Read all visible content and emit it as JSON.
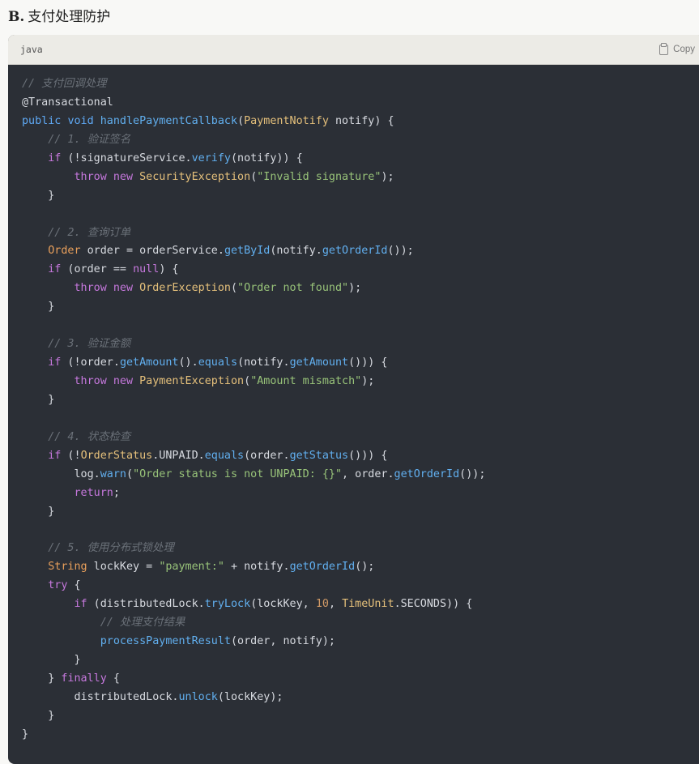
{
  "heading": {
    "prefix": "B.",
    "title": "支付处理防护"
  },
  "code_block": {
    "language": "java",
    "copy_label": "Copy",
    "lines": [
      [
        [
          "cm",
          "// 支付回调处理"
        ]
      ],
      [
        [
          "an",
          "@Transactional"
        ]
      ],
      [
        [
          "bl",
          "public"
        ],
        [
          "pl",
          " "
        ],
        [
          "bl",
          "void"
        ],
        [
          "pl",
          " "
        ],
        [
          "fn",
          "handlePaymentCallback"
        ],
        [
          "pl",
          "("
        ],
        [
          "ty",
          "PaymentNotify"
        ],
        [
          "pl",
          " notify) {"
        ]
      ],
      [
        [
          "pl",
          "    "
        ],
        [
          "cm",
          "// 1. 验证签名"
        ]
      ],
      [
        [
          "pl",
          "    "
        ],
        [
          "kw",
          "if"
        ],
        [
          "pl",
          " (!signatureService."
        ],
        [
          "fn",
          "verify"
        ],
        [
          "pl",
          "(notify)) {"
        ]
      ],
      [
        [
          "pl",
          "        "
        ],
        [
          "kw",
          "throw"
        ],
        [
          "pl",
          " "
        ],
        [
          "kw",
          "new"
        ],
        [
          "pl",
          " "
        ],
        [
          "ty",
          "SecurityException"
        ],
        [
          "pl",
          "("
        ],
        [
          "st",
          "\"Invalid signature\""
        ],
        [
          "pl",
          ");"
        ]
      ],
      [
        [
          "pl",
          "    }"
        ]
      ],
      [
        [
          "pl",
          ""
        ]
      ],
      [
        [
          "pl",
          "    "
        ],
        [
          "cm",
          "// 2. 查询订单"
        ]
      ],
      [
        [
          "pl",
          "    "
        ],
        [
          "or",
          "Order"
        ],
        [
          "pl",
          " order = orderService."
        ],
        [
          "fn",
          "getById"
        ],
        [
          "pl",
          "(notify."
        ],
        [
          "fn",
          "getOrderId"
        ],
        [
          "pl",
          "());"
        ]
      ],
      [
        [
          "pl",
          "    "
        ],
        [
          "kw",
          "if"
        ],
        [
          "pl",
          " (order == "
        ],
        [
          "kw",
          "null"
        ],
        [
          "pl",
          ") {"
        ]
      ],
      [
        [
          "pl",
          "        "
        ],
        [
          "kw",
          "throw"
        ],
        [
          "pl",
          " "
        ],
        [
          "kw",
          "new"
        ],
        [
          "pl",
          " "
        ],
        [
          "ty",
          "OrderException"
        ],
        [
          "pl",
          "("
        ],
        [
          "st",
          "\"Order not found\""
        ],
        [
          "pl",
          ");"
        ]
      ],
      [
        [
          "pl",
          "    }"
        ]
      ],
      [
        [
          "pl",
          ""
        ]
      ],
      [
        [
          "pl",
          "    "
        ],
        [
          "cm",
          "// 3. 验证金额"
        ]
      ],
      [
        [
          "pl",
          "    "
        ],
        [
          "kw",
          "if"
        ],
        [
          "pl",
          " (!order."
        ],
        [
          "fn",
          "getAmount"
        ],
        [
          "pl",
          "()."
        ],
        [
          "fn",
          "equals"
        ],
        [
          "pl",
          "(notify."
        ],
        [
          "fn",
          "getAmount"
        ],
        [
          "pl",
          "())) {"
        ]
      ],
      [
        [
          "pl",
          "        "
        ],
        [
          "kw",
          "throw"
        ],
        [
          "pl",
          " "
        ],
        [
          "kw",
          "new"
        ],
        [
          "pl",
          " "
        ],
        [
          "ty",
          "PaymentException"
        ],
        [
          "pl",
          "("
        ],
        [
          "st",
          "\"Amount mismatch\""
        ],
        [
          "pl",
          ");"
        ]
      ],
      [
        [
          "pl",
          "    }"
        ]
      ],
      [
        [
          "pl",
          ""
        ]
      ],
      [
        [
          "pl",
          "    "
        ],
        [
          "cm",
          "// 4. 状态检查"
        ]
      ],
      [
        [
          "pl",
          "    "
        ],
        [
          "kw",
          "if"
        ],
        [
          "pl",
          " (!"
        ],
        [
          "ty",
          "OrderStatus"
        ],
        [
          "pl",
          ".UNPAID."
        ],
        [
          "fn",
          "equals"
        ],
        [
          "pl",
          "(order."
        ],
        [
          "fn",
          "getStatus"
        ],
        [
          "pl",
          "())) {"
        ]
      ],
      [
        [
          "pl",
          "        log."
        ],
        [
          "fn",
          "warn"
        ],
        [
          "pl",
          "("
        ],
        [
          "st",
          "\"Order status is not UNPAID: {}\""
        ],
        [
          "pl",
          ", order."
        ],
        [
          "fn",
          "getOrderId"
        ],
        [
          "pl",
          "());"
        ]
      ],
      [
        [
          "pl",
          "        "
        ],
        [
          "kw",
          "return"
        ],
        [
          "pl",
          ";"
        ]
      ],
      [
        [
          "pl",
          "    }"
        ]
      ],
      [
        [
          "pl",
          ""
        ]
      ],
      [
        [
          "pl",
          "    "
        ],
        [
          "cm",
          "// 5. 使用分布式锁处理"
        ]
      ],
      [
        [
          "pl",
          "    "
        ],
        [
          "or",
          "String"
        ],
        [
          "pl",
          " lockKey = "
        ],
        [
          "st",
          "\"payment:\""
        ],
        [
          "pl",
          " + notify."
        ],
        [
          "fn",
          "getOrderId"
        ],
        [
          "pl",
          "();"
        ]
      ],
      [
        [
          "pl",
          "    "
        ],
        [
          "kw",
          "try"
        ],
        [
          "pl",
          " {"
        ]
      ],
      [
        [
          "pl",
          "        "
        ],
        [
          "kw",
          "if"
        ],
        [
          "pl",
          " (distributedLock."
        ],
        [
          "fn",
          "tryLock"
        ],
        [
          "pl",
          "(lockKey, "
        ],
        [
          "nu",
          "10"
        ],
        [
          "pl",
          ", "
        ],
        [
          "ty",
          "TimeUnit"
        ],
        [
          "pl",
          ".SECONDS)) {"
        ]
      ],
      [
        [
          "pl",
          "            "
        ],
        [
          "cm",
          "// 处理支付结果"
        ]
      ],
      [
        [
          "pl",
          "            "
        ],
        [
          "fn",
          "processPaymentResult"
        ],
        [
          "pl",
          "(order, notify);"
        ]
      ],
      [
        [
          "pl",
          "        }"
        ]
      ],
      [
        [
          "pl",
          "    } "
        ],
        [
          "kw",
          "finally"
        ],
        [
          "pl",
          " {"
        ]
      ],
      [
        [
          "pl",
          "        distributedLock."
        ],
        [
          "fn",
          "unlock"
        ],
        [
          "pl",
          "(lockKey);"
        ]
      ],
      [
        [
          "pl",
          "    }"
        ]
      ],
      [
        [
          "pl",
          "}"
        ]
      ]
    ]
  }
}
